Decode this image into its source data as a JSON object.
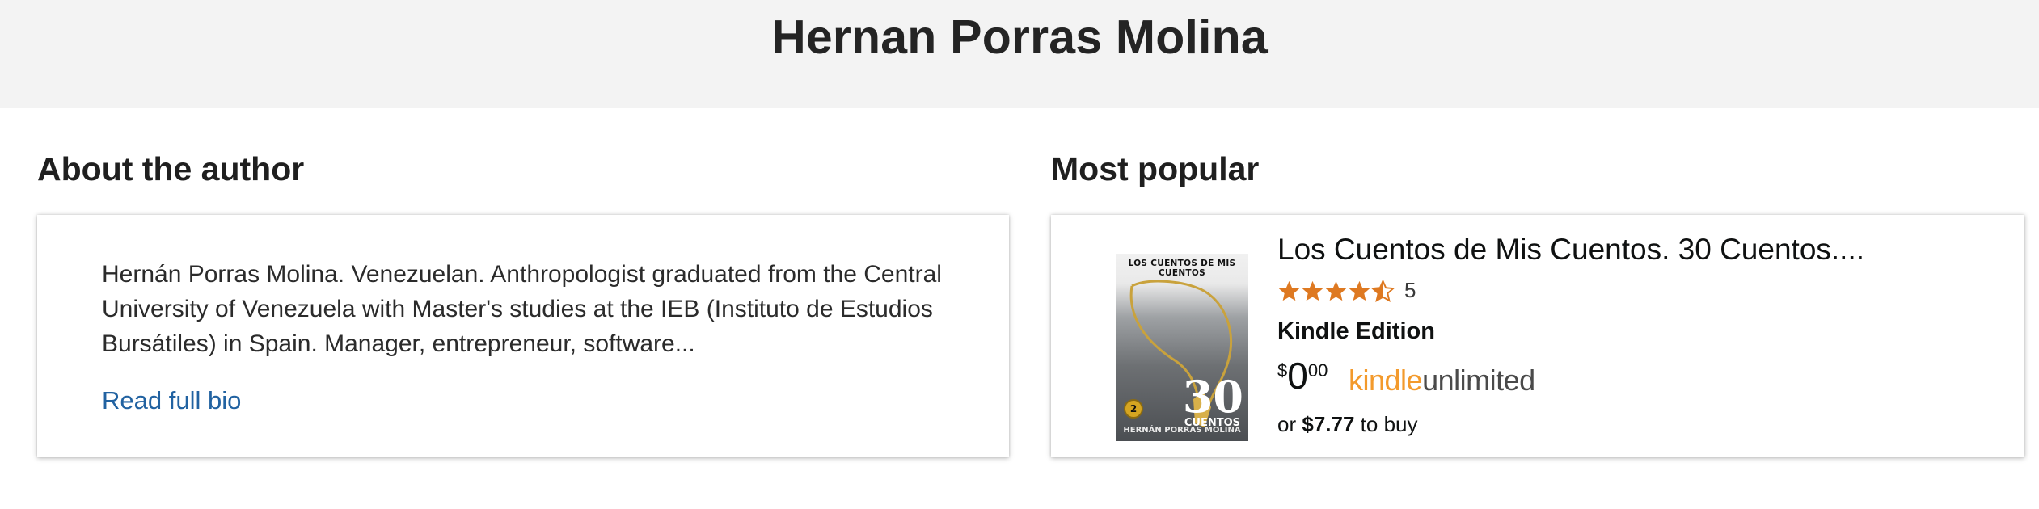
{
  "header": {
    "author_name": "Hernan Porras Molina"
  },
  "about": {
    "title": "About the author",
    "bio_text": "Hernán Porras Molina. Venezuelan. Anthropologist graduated from the Central University of Venezuela with Master's studies at the IEB (Instituto de Estudios Bursátiles) in Spain. Manager, entrepreneur, software...",
    "read_more": "Read full bio"
  },
  "popular": {
    "title": "Most popular",
    "book": {
      "title": "Los Cuentos de Mis Cuentos. 30 Cuentos....",
      "rating": 4.5,
      "rating_count": "5",
      "format": "Kindle Edition",
      "price_symbol": "$",
      "price_whole": "0",
      "price_fraction": "00",
      "ku_kindle": "kindle",
      "ku_unlimited": "unlimited",
      "buy_prefix": "or",
      "buy_price": "$7.77",
      "buy_suffix": "to buy",
      "cover": {
        "top_text": "LOS CUENTOS DE MIS CUENTOS",
        "number": "30",
        "subtitle": "CUENTOS",
        "author": "HERNÁN PORRAS MOLINA",
        "badge": "2"
      }
    }
  },
  "colors": {
    "header_bg": "#f3f3f3",
    "link": "#2162a1",
    "star": "#de7921",
    "kindle_orange": "#f39a2c"
  }
}
